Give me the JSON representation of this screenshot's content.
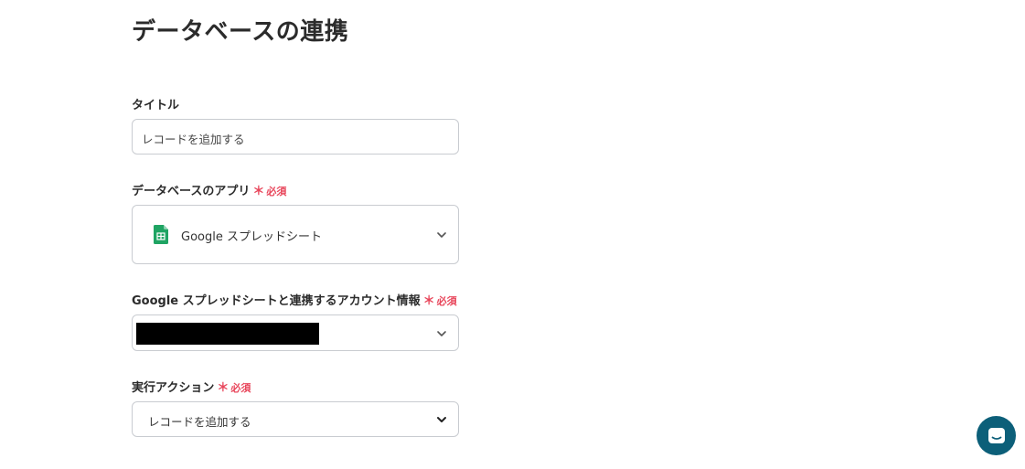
{
  "page": {
    "title": "データベースの連携"
  },
  "required_mark": "必須",
  "fields": {
    "title": {
      "label": "タイトル",
      "value": "レコードを追加する"
    },
    "app": {
      "label": "データベースのアプリ",
      "value": "Google スプレッドシート",
      "icon": "google-sheets-icon"
    },
    "account": {
      "label": "Google スプレッドシートと連携するアカウント情報"
    },
    "action": {
      "label": "実行アクション",
      "value": "レコードを追加する"
    }
  },
  "colors": {
    "required": "#e8455a",
    "border": "#c9ccd1",
    "chat_button": "#0c5f79",
    "sheets_green": "#1fa463"
  }
}
